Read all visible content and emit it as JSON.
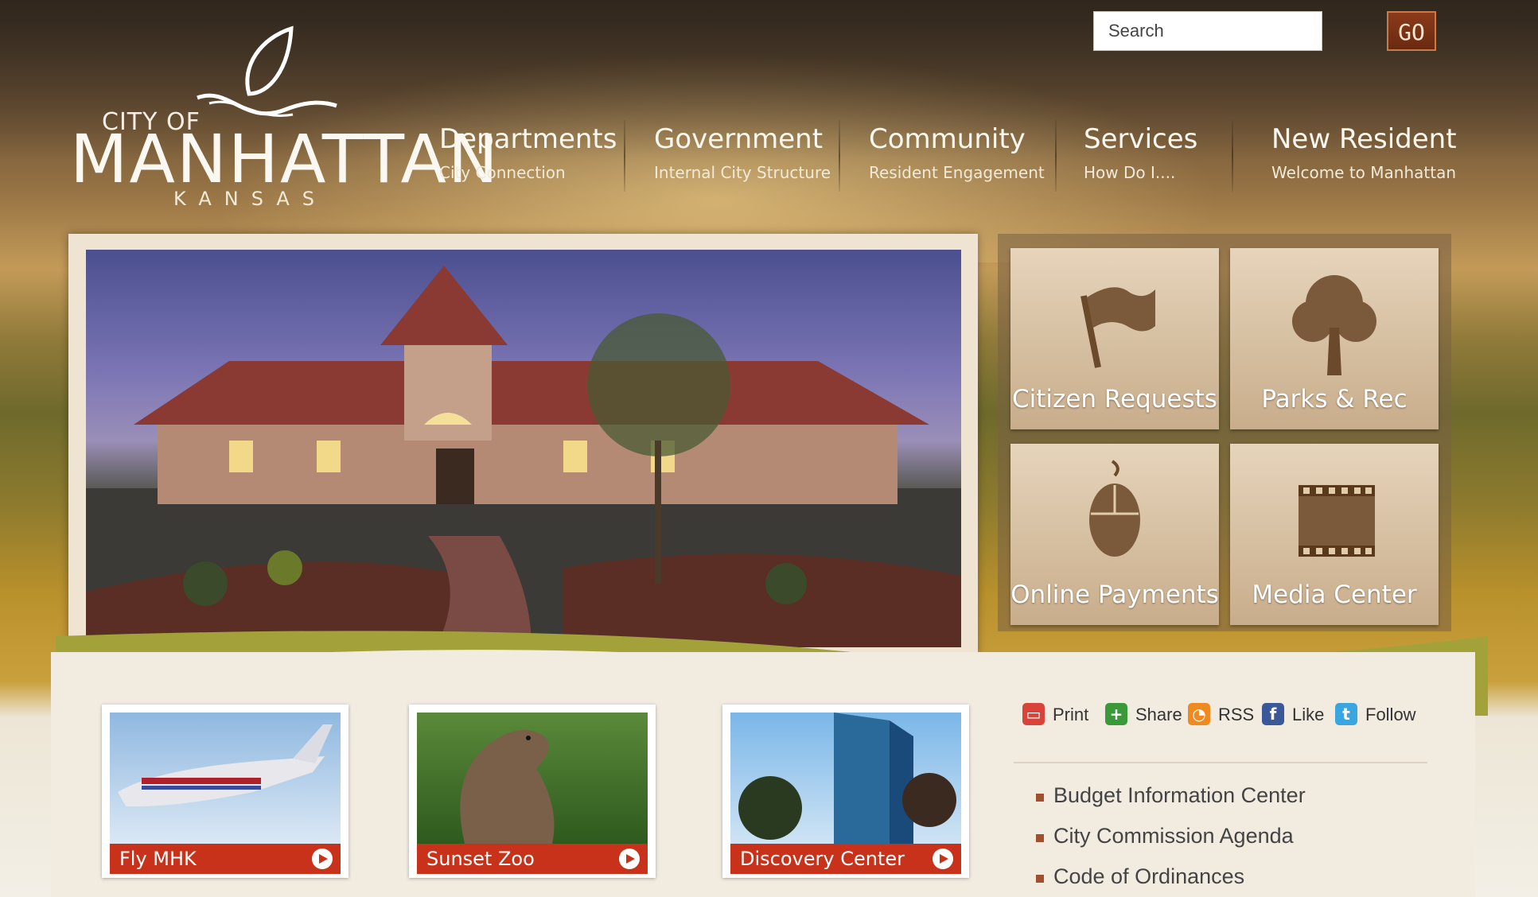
{
  "logo": {
    "line1": "CITY OF",
    "line2": "MANHATTAN",
    "line3": "KANSAS"
  },
  "search": {
    "placeholder": "Search",
    "button_label": "GO"
  },
  "nav": [
    {
      "title": "Departments",
      "subtitle": "City Connection"
    },
    {
      "title": "Government",
      "subtitle": "Internal City Structure"
    },
    {
      "title": "Community",
      "subtitle": "Resident Engagement"
    },
    {
      "title": "Services",
      "subtitle": "How Do I...."
    },
    {
      "title": "New Resident",
      "subtitle": "Welcome to Manhattan"
    }
  ],
  "tiles": [
    {
      "label": "Citizen Requests",
      "icon": "flag-icon"
    },
    {
      "label": "Parks & Rec",
      "icon": "tree-icon"
    },
    {
      "label": "Online Payments",
      "icon": "mouse-icon"
    },
    {
      "label": "Media Center",
      "icon": "film-icon"
    }
  ],
  "features": [
    {
      "label": "Fly MHK"
    },
    {
      "label": "Sunset Zoo"
    },
    {
      "label": "Discovery Center"
    }
  ],
  "social": [
    {
      "label": "Print",
      "icon": "print-icon",
      "color": "#d8443a"
    },
    {
      "label": "Share",
      "icon": "share-icon",
      "color": "#3a9a3a"
    },
    {
      "label": "RSS",
      "icon": "rss-icon",
      "color": "#ee8a20"
    },
    {
      "label": "Like",
      "icon": "facebook-icon",
      "color": "#3b5998"
    },
    {
      "label": "Follow",
      "icon": "twitter-icon",
      "color": "#3aa6e0"
    }
  ],
  "quick_links": [
    "Budget Information Center",
    "City Commission Agenda",
    "Code of Ordinances"
  ],
  "colors": {
    "accent_red": "#c9321a",
    "go_button": "#7a3214",
    "bullet": "#a0502e"
  }
}
